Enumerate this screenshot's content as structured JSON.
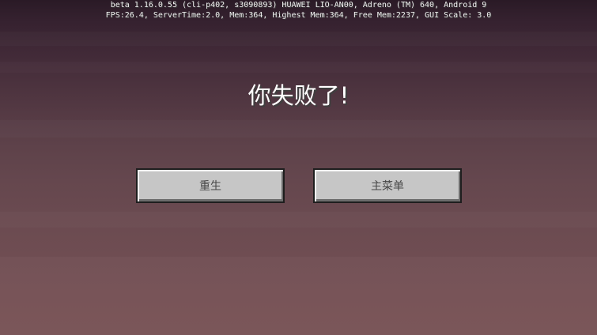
{
  "debug": {
    "line1": "beta 1.16.0.55 (cli-p402, s3090893) HUAWEI LIO-AN00, Adreno (TM) 640, Android 9",
    "line2": "FPS:26.4, ServerTime:2.0, Mem:364, Highest Mem:364, Free Mem:2237, GUI Scale: 3.0"
  },
  "death_screen": {
    "title": "你失败了!",
    "respawn_label": "重生",
    "main_menu_label": "主菜单"
  },
  "colors": {
    "button_face": "#c6c6c6",
    "button_text": "#474747",
    "title_text": "#ffffff"
  }
}
